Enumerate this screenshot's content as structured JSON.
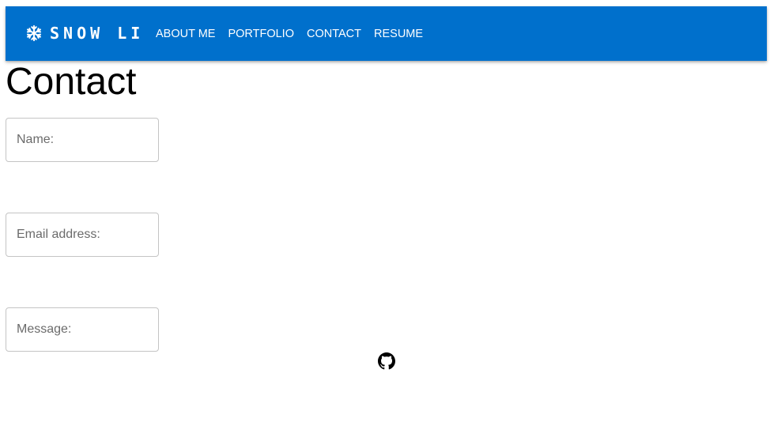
{
  "header": {
    "brand_text": "SNOW LI",
    "brand_icon": "snowflake-icon",
    "background_color": "#0070cc",
    "nav": [
      {
        "label": "ABOUT ME"
      },
      {
        "label": "PORTFOLIO"
      },
      {
        "label": "CONTACT"
      },
      {
        "label": "RESUME"
      }
    ]
  },
  "main": {
    "title": "Contact",
    "form": {
      "name_placeholder": "Name:",
      "email_placeholder": "Email address:",
      "message_placeholder": "Message:"
    }
  },
  "footer": {
    "github_icon": "github-icon"
  }
}
